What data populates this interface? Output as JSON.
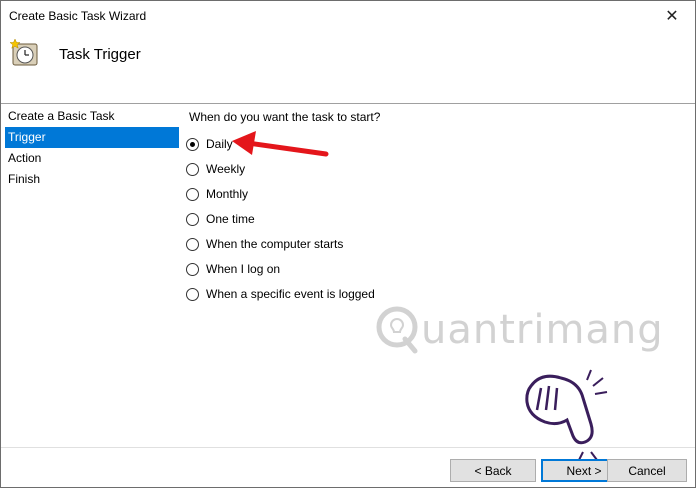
{
  "window": {
    "title": "Create Basic Task Wizard",
    "close_glyph": "✕"
  },
  "header": {
    "title": "Task Trigger",
    "icon": "task-scheduler-clock-icon"
  },
  "nav": {
    "items": [
      {
        "label": "Create a Basic Task",
        "selected": false
      },
      {
        "label": "Trigger",
        "selected": true
      },
      {
        "label": "Action",
        "selected": false
      },
      {
        "label": "Finish",
        "selected": false
      }
    ]
  },
  "trigger": {
    "question": "When do you want the task to start?",
    "options": [
      {
        "label": "Daily",
        "checked": true
      },
      {
        "label": "Weekly",
        "checked": false
      },
      {
        "label": "Monthly",
        "checked": false
      },
      {
        "label": "One time",
        "checked": false
      },
      {
        "label": "When the computer starts",
        "checked": false
      },
      {
        "label": "When I log on",
        "checked": false
      },
      {
        "label": "When a specific event is logged",
        "checked": false
      }
    ]
  },
  "watermark": {
    "text": "uantrimang"
  },
  "buttons": {
    "back": "< Back",
    "next": "Next >",
    "cancel": "Cancel"
  },
  "colors": {
    "selection": "#0078d7",
    "annotation_arrow": "#e4161b"
  }
}
